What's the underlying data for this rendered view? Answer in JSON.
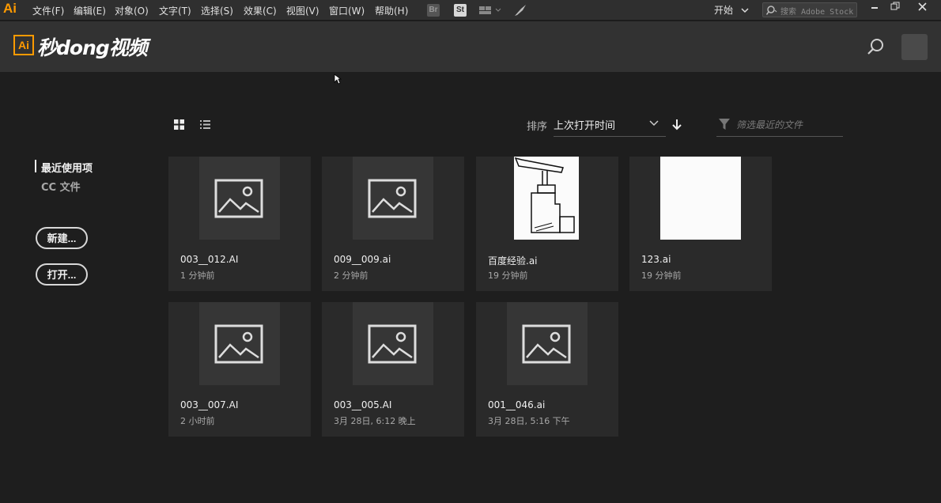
{
  "menubar": {
    "app_logo": "Ai",
    "menus": [
      "文件(F)",
      "编辑(E)",
      "对象(O)",
      "文字(T)",
      "选择(S)",
      "效果(C)",
      "视图(V)",
      "窗口(W)",
      "帮助(H)"
    ],
    "bridge_label": "Br",
    "stock_label": "St",
    "workspace_label": "开始",
    "stock_search_placeholder": "搜索 Adobe Stock"
  },
  "header": {
    "brand_ai": "Ai",
    "brand_text": "秒dong视频"
  },
  "sidebar": {
    "recent_label": "最近使用项",
    "cc_files_label": "CC 文件",
    "new_button": "新建...",
    "open_button": "打开..."
  },
  "toolbar": {
    "sort_label": "排序",
    "sort_value": "上次打开时间",
    "filter_placeholder": "筛选最近的文件"
  },
  "files": [
    {
      "name": "003__012.AI",
      "time": "1 分钟前",
      "thumb": "placeholder"
    },
    {
      "name": "009__009.ai",
      "time": "2 分钟前",
      "thumb": "placeholder"
    },
    {
      "name": "百度经验.ai",
      "time": "19 分钟前",
      "thumb": "sketch"
    },
    {
      "name": "123.ai",
      "time": "19 分钟前",
      "thumb": "blank"
    },
    {
      "name": "003__007.AI",
      "time": "2 小时前",
      "thumb": "placeholder"
    },
    {
      "name": "003__005.AI",
      "time": "3月 28日, 6:12 晚上",
      "thumb": "placeholder"
    },
    {
      "name": "001__046.ai",
      "time": "3月 28日, 5:16 下午",
      "thumb": "placeholder"
    }
  ],
  "colors": {
    "accent": "#ff9a00",
    "background": "#1e1e1e",
    "card": "#2a2a2a"
  }
}
